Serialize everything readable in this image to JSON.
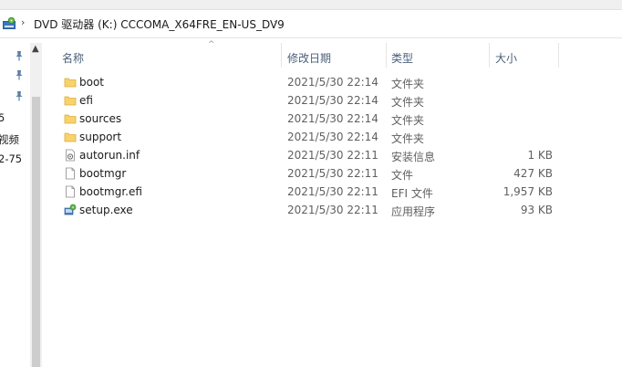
{
  "address": {
    "drive_icon": "dvd-drive-icon",
    "path_text": "DVD 驱动器 (K:) CCCOMA_X64FRE_EN-US_DV9",
    "separator_left": "›",
    "separator_right": "›"
  },
  "navigation": {
    "scroll_up": "▲",
    "truncated_items": [
      "5",
      "视频",
      "2-75"
    ]
  },
  "columns": {
    "name": "名称",
    "date": "修改日期",
    "type": "类型",
    "size": "大小",
    "sort_indicator": "^"
  },
  "files": [
    {
      "name": "boot",
      "date": "2021/5/30 22:14",
      "type": "文件夹",
      "size": "",
      "icon": "folder-icon"
    },
    {
      "name": "efi",
      "date": "2021/5/30 22:14",
      "type": "文件夹",
      "size": "",
      "icon": "folder-icon"
    },
    {
      "name": "sources",
      "date": "2021/5/30 22:14",
      "type": "文件夹",
      "size": "",
      "icon": "folder-icon"
    },
    {
      "name": "support",
      "date": "2021/5/30 22:14",
      "type": "文件夹",
      "size": "",
      "icon": "folder-icon"
    },
    {
      "name": "autorun.inf",
      "date": "2021/5/30 22:11",
      "type": "安装信息",
      "size": "1 KB",
      "icon": "settings-file-icon"
    },
    {
      "name": "bootmgr",
      "date": "2021/5/30 22:11",
      "type": "文件",
      "size": "427 KB",
      "icon": "file-icon"
    },
    {
      "name": "bootmgr.efi",
      "date": "2021/5/30 22:11",
      "type": "EFI 文件",
      "size": "1,957 KB",
      "icon": "file-icon"
    },
    {
      "name": "setup.exe",
      "date": "2021/5/30 22:11",
      "type": "应用程序",
      "size": "93 KB",
      "icon": "setup-app-icon"
    }
  ],
  "colors": {
    "folder": "#f6d36b",
    "header_text": "#4c607a",
    "secondary_text": "#606060"
  }
}
